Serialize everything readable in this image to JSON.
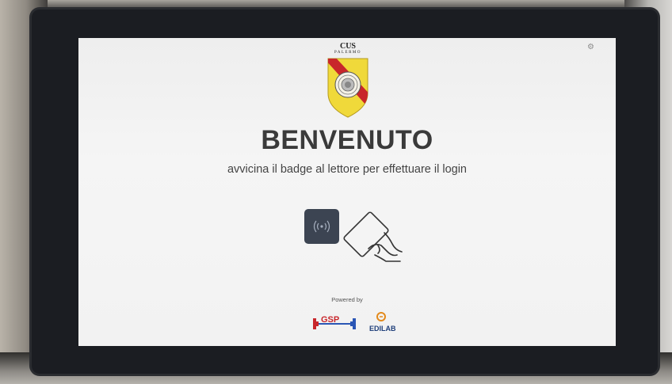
{
  "app": {
    "logo_title": "CUS",
    "logo_subtitle": "PALERMO",
    "heading": "BENVENUTO",
    "instruction": "avvicina il badge al lettore per effettuare il login",
    "powered_by": "Powered by",
    "settings_icon": "gear-icon"
  },
  "sponsors": {
    "gsp": "GSP",
    "edilab": "EDILAB"
  },
  "colors": {
    "background": "#f2f2f2",
    "heading": "#3a3a3a",
    "reader": "#3c4452",
    "shield_yellow": "#f0d93a",
    "shield_red": "#c8262b"
  }
}
